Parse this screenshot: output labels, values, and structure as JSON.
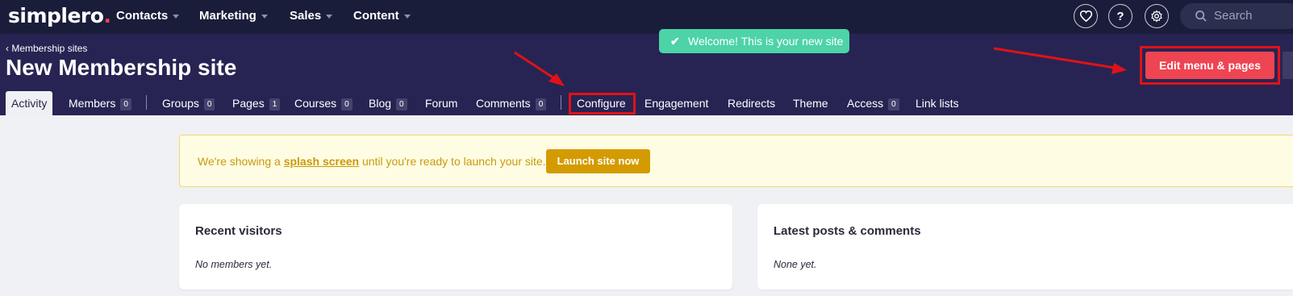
{
  "app": {
    "logo_main": "simplero",
    "logo_dot": "."
  },
  "topnav": {
    "items": [
      {
        "label": "Contacts"
      },
      {
        "label": "Marketing"
      },
      {
        "label": "Sales"
      },
      {
        "label": "Content"
      }
    ],
    "icons": [
      "heart-icon",
      "help-icon",
      "settings-icon"
    ],
    "help_glyph": "?",
    "search_placeholder": "Search"
  },
  "header": {
    "breadcrumb": "‹ Membership sites",
    "title": "New Membership site",
    "toast": "Welcome! This is your new site",
    "edit_button": "Edit menu & pages"
  },
  "tabs": [
    {
      "label": "Activity",
      "count": null,
      "active": true
    },
    {
      "label": "Members",
      "count": "0"
    },
    {
      "label": "Groups",
      "count": "0"
    },
    {
      "label": "Pages",
      "count": "1"
    },
    {
      "label": "Courses",
      "count": "0"
    },
    {
      "label": "Blog",
      "count": "0"
    },
    {
      "label": "Forum",
      "count": null
    },
    {
      "label": "Comments",
      "count": "0"
    },
    {
      "label": "Configure",
      "count": null,
      "highlighted": true
    },
    {
      "label": "Engagement",
      "count": null
    },
    {
      "label": "Redirects",
      "count": null
    },
    {
      "label": "Theme",
      "count": null
    },
    {
      "label": "Access",
      "count": "0"
    },
    {
      "label": "Link lists",
      "count": null
    }
  ],
  "banner": {
    "text_before": "We're showing a ",
    "link": "splash screen",
    "text_after": " until you're ready to launch your site.",
    "button": "Launch site now"
  },
  "cards": [
    {
      "title": "Recent visitors",
      "empty": "No members yet."
    },
    {
      "title": "Latest posts & comments",
      "empty": "None yet."
    }
  ],
  "colors": {
    "nav_bg": "#1a1d3a",
    "header_bg": "#272453",
    "accent_red": "#ef4452",
    "toast_green": "#4dd3a7",
    "launch_gold": "#d49b00",
    "annotation_red": "#e01218"
  }
}
